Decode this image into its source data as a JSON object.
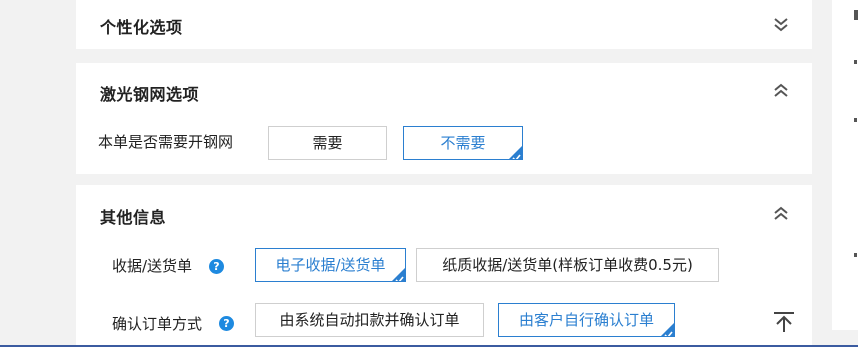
{
  "sections": {
    "personalization": {
      "title": "个性化选项",
      "expanded": false
    },
    "laser_stencil": {
      "title": "激光钢网选项",
      "expanded": true,
      "question": "本单是否需要开钢网",
      "options": [
        "需要",
        "不需要"
      ],
      "selected": "不需要"
    },
    "other_info": {
      "title": "其他信息",
      "expanded": true,
      "receipt": {
        "label": "收据/送货单",
        "help": "?",
        "options": [
          "电子收据/送货单",
          "纸质收据/送货单(样板订单收费0.5元)"
        ],
        "selected": "电子收据/送货单"
      },
      "confirm_method": {
        "label": "确认订单方式",
        "help": "?",
        "options": [
          "由系统自动扣款并确认订单",
          "由客户自行确认订单"
        ],
        "selected": "由客户自行确认订单"
      }
    }
  },
  "colors": {
    "accent": "#2b7fd0",
    "help_icon": "#1e8ae0",
    "background": "#f2f2f2"
  },
  "icons": {
    "collapse": "chevron-double-up-icon",
    "expand": "chevron-double-down-icon",
    "selected": "check-corner-icon",
    "help": "question-circle-icon",
    "top": "back-to-top-icon"
  }
}
